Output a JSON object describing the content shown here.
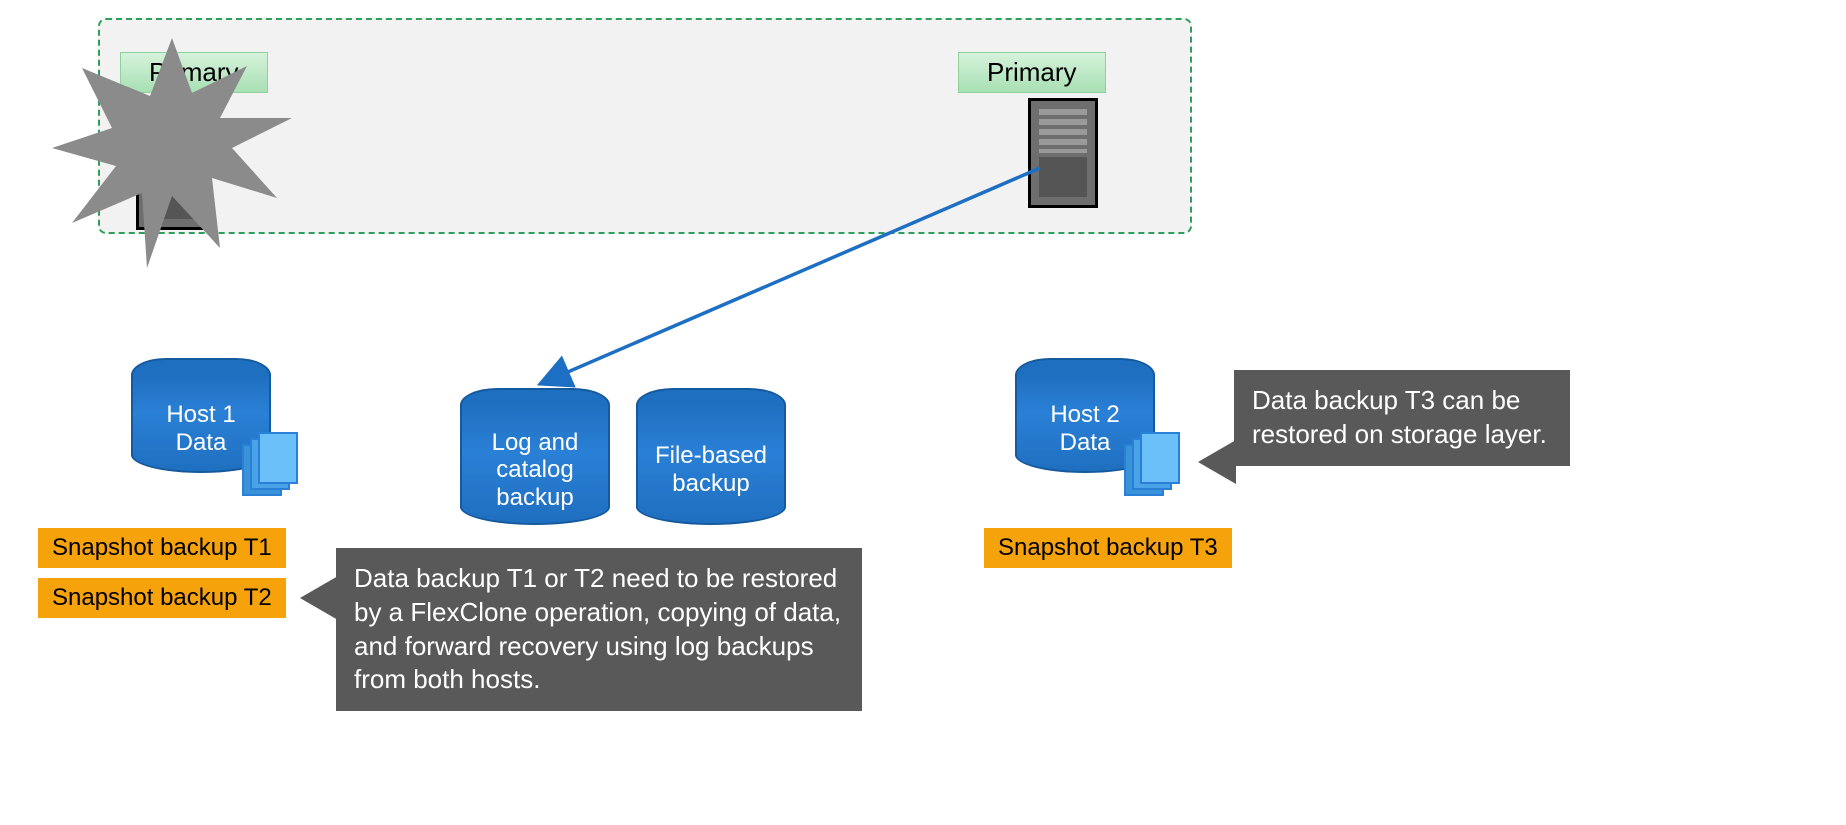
{
  "container": {
    "primary_left_label": "Primary",
    "primary_right_label": "Primary"
  },
  "cylinders": {
    "host1": "Host 1\nData",
    "log": "Log and\ncatalog\nbackup",
    "file": "File-based\nbackup",
    "host2": "Host 2\nData"
  },
  "tags": {
    "t1": "Snapshot backup T1",
    "t2": "Snapshot backup T2",
    "t3": "Snapshot backup T3"
  },
  "callouts": {
    "left": "Data backup T1 or T2 need to be restored by a FlexClone operation, copying of data, and forward recovery using log backups from both hosts.",
    "right": "Data backup T3 can be restored on storage layer."
  },
  "colors": {
    "dash_border": "#2e9e5b",
    "cyl_blue": "#1f6fc0",
    "tag_orange": "#f6a20b",
    "callout_grey": "#595959",
    "arrow_blue": "#1d6fc4"
  }
}
